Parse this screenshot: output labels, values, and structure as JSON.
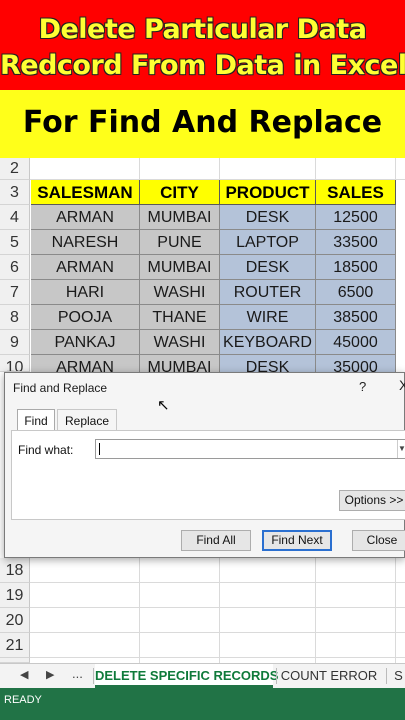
{
  "banner": {
    "line1": "Delete Particular Data",
    "line2": "Redcord From Data in Excel",
    "subtitle": "For Find And Replace"
  },
  "rows": [
    "2",
    "3",
    "4",
    "5",
    "6",
    "7",
    "8",
    "9",
    "10",
    "18",
    "19",
    "20",
    "21"
  ],
  "table": {
    "headers": [
      "SALESMAN",
      "CITY",
      "PRODUCT",
      "SALES"
    ],
    "records": [
      [
        "ARMAN",
        "MUMBAI",
        "DESK",
        "12500"
      ],
      [
        "NARESH",
        "PUNE",
        "LAPTOP",
        "33500"
      ],
      [
        "ARMAN",
        "MUMBAI",
        "DESK",
        "18500"
      ],
      [
        "HARI",
        "WASHI",
        "ROUTER",
        "6500"
      ],
      [
        "POOJA",
        "THANE",
        "WIRE",
        "38500"
      ],
      [
        "PANKAJ",
        "WASHI",
        "KEYBOARD",
        "45000"
      ],
      [
        "ARMAN",
        "MUMBAI",
        "DESK",
        "35000"
      ]
    ]
  },
  "dialog": {
    "title": "Find and Replace",
    "help": "?",
    "close_glyph": "X",
    "tab_find": "Find",
    "tab_replace": "Replace",
    "find_what_label": "Find what:",
    "find_what_value": "",
    "options": "Options >>",
    "find_all": "Find All",
    "find_next": "Find Next",
    "close": "Close"
  },
  "sheets": {
    "nav_prev": "◀",
    "nav_next": "▶",
    "more": "...",
    "active": "DELETE SPECIFIC RECORDS",
    "second": "COUNT ERROR",
    "third": "S"
  },
  "status": "READY",
  "colors": {
    "banner_red": "#ff0000",
    "banner_yellow": "#ffff1a",
    "header_yellow": "#ffff00",
    "status_green": "#217346"
  }
}
